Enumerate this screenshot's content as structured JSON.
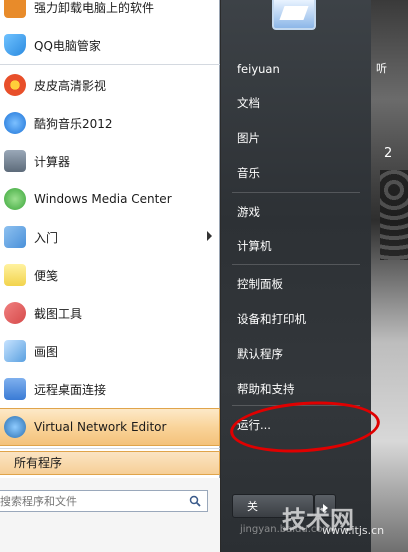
{
  "left_menu": {
    "items": [
      {
        "label": "强力卸载电脑上的软件",
        "icon": "uninstall-icon",
        "color": "#e88b2a"
      },
      {
        "label": "QQ电脑管家",
        "icon": "shield-icon",
        "color": "#2c8be0"
      },
      {
        "label": "皮皮高清影视",
        "icon": "video-icon",
        "color": "#e84f2a"
      },
      {
        "label": "酷狗音乐2012",
        "icon": "music-icon",
        "color": "#1e74d8"
      },
      {
        "label": "计算器",
        "icon": "calculator-icon",
        "color": "#5d6b7a"
      },
      {
        "label": "Windows Media Center",
        "icon": "media-center-icon",
        "color": "#3aa63a"
      },
      {
        "label": "入门",
        "icon": "getting-started-icon",
        "color": "#4a90d9"
      },
      {
        "label": "便笺",
        "icon": "sticky-note-icon",
        "color": "#f2d34c"
      },
      {
        "label": "截图工具",
        "icon": "scissors-icon",
        "color": "#d64a4a"
      },
      {
        "label": "画图",
        "icon": "paint-icon",
        "color": "#5aa0e0"
      },
      {
        "label": "远程桌面连接",
        "icon": "remote-desktop-icon",
        "color": "#3a7bd5"
      },
      {
        "label": "Virtual Network Editor",
        "icon": "network-icon",
        "color": "#2a6fb0"
      }
    ],
    "all_programs": "所有程序",
    "search_placeholder": "搜索程序和文件"
  },
  "right_menu": {
    "items": [
      "feiyuan",
      "文档",
      "图片",
      "音乐",
      "游戏",
      "计算机",
      "控制面板",
      "设备和打印机",
      "默认程序",
      "帮助和支持",
      "运行..."
    ],
    "shutdown_label": "关"
  },
  "desktop": {
    "text_top": "听",
    "text_number": "2"
  },
  "watermark": {
    "brand": "技术网",
    "url": "www.itjs.cn",
    "baidu": "jingyan.baidu.com"
  }
}
